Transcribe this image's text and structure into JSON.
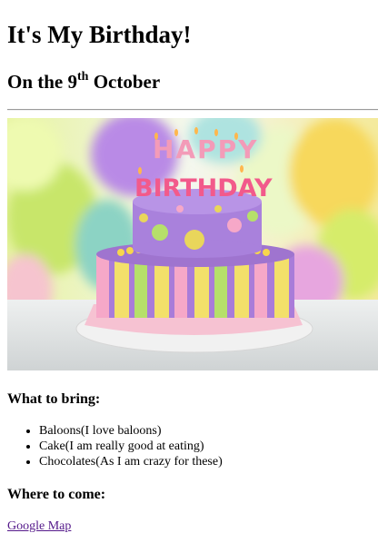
{
  "title": "It's My Birthday!",
  "date": {
    "prefix": "On the 9",
    "suffix": "th",
    "month": " October"
  },
  "image": {
    "banner_text_line1": "HAPPY",
    "banner_text_line2": "BIRTHDAY"
  },
  "bring": {
    "heading": "What to bring:",
    "items": [
      "Baloons(I love baloons)",
      "Cake(I am really good at eating)",
      "Chocolates(As I am crazy for these)"
    ]
  },
  "where": {
    "heading": "Where to come:",
    "link_label": "Google Map"
  },
  "colors": {
    "link": "#551a8b",
    "rule": "#9b9b9b"
  }
}
